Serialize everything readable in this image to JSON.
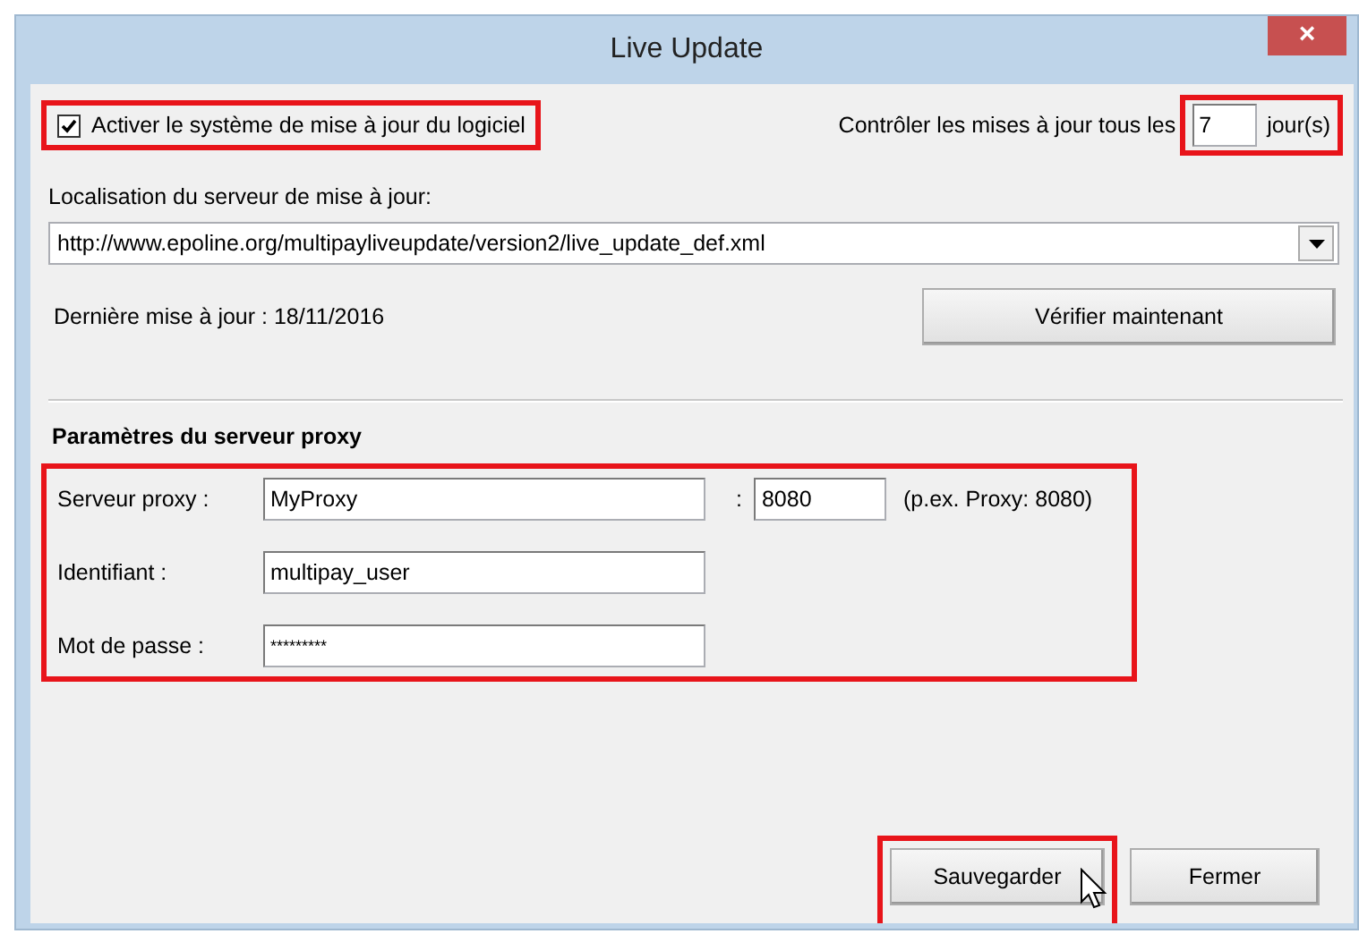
{
  "window": {
    "title": "Live Update",
    "close": "×"
  },
  "enable": {
    "label": "Activer le système de mise à jour du logiciel",
    "checked": true,
    "highlighted": true
  },
  "interval": {
    "label": "Contrôler les mises à jour tous les",
    "value": "7",
    "unit": "jour(s)",
    "highlighted": true
  },
  "server": {
    "label": "Localisation du serveur de mise à jour:",
    "value": "http://www.epoline.org/multipayliveupdate/version2/live_update_def.xml"
  },
  "last_update": "Dernière mise à jour : 18/11/2016",
  "check_button": "Vérifier maintenant",
  "proxy": {
    "heading": "Paramètres du serveur proxy",
    "highlighted": true,
    "server_label": "Serveur proxy :",
    "server_value": "MyProxy",
    "separator": ":",
    "port_value": "8080",
    "port_hint": "(p.ex. Proxy: 8080)",
    "user_label": "Identifiant :",
    "user_value": "multipay_user",
    "password_label": "Mot de passe :",
    "password_value": "*********"
  },
  "buttons": [
    {
      "label": "Sauvegarder",
      "highlighted": true,
      "hovered": true
    },
    {
      "label": "Fermer",
      "highlighted": false,
      "hovered": false
    }
  ]
}
